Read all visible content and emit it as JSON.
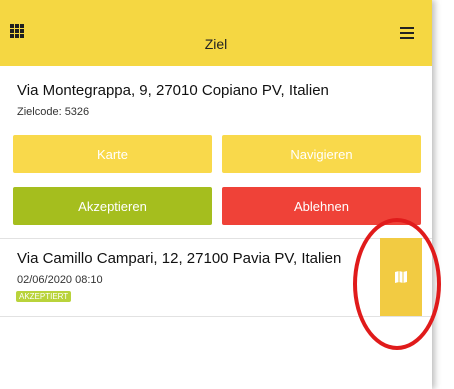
{
  "header": {
    "title": "Ziel",
    "grid_icon": "grid-icon",
    "menu_icon": "hamburger-menu-icon",
    "color": "#f5d742"
  },
  "destination": {
    "address": "Via Montegrappa, 9, 27010 Copiano PV, Italien",
    "code": "Zielcode: 5326"
  },
  "actions": {
    "map_label": "Karte",
    "navigate_label": "Navigieren",
    "accept_label": "Akzeptieren",
    "reject_label": "Ablehnen",
    "yellow": "#f9d94b",
    "green": "#a5be1e",
    "red": "#ef4238"
  },
  "entry": {
    "address": "Via Camillo Campari, 12, 27100 Pavia PV, Italien",
    "datetime": "02/06/2020 08:10",
    "status": "AKZEPTIERT",
    "map_icon": "map-icon"
  }
}
